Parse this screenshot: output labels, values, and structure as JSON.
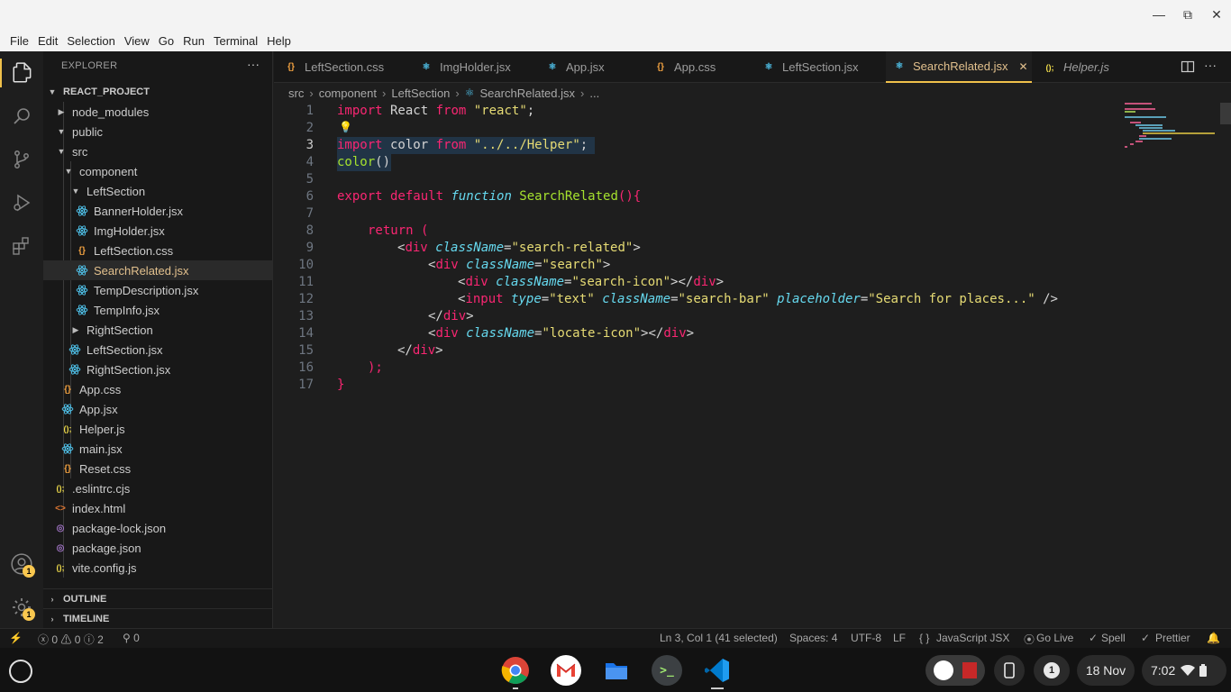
{
  "menu": [
    "File",
    "Edit",
    "Selection",
    "View",
    "Go",
    "Run",
    "Terminal",
    "Help"
  ],
  "window_controls": {
    "minimize": "—",
    "maximize": "⧉",
    "close": "✕"
  },
  "explorer": {
    "title": "EXPLORER",
    "more": "···",
    "project": "REACT_PROJECT",
    "items": [
      {
        "label": "node_modules",
        "kind": "folder"
      },
      {
        "label": "public",
        "kind": "folder"
      },
      {
        "label": "src",
        "kind": "folder-open"
      },
      {
        "label": "component",
        "kind": "folder-open"
      },
      {
        "label": "LeftSection",
        "kind": "folder-open"
      },
      {
        "label": "BannerHolder.jsx",
        "kind": "react"
      },
      {
        "label": "ImgHolder.jsx",
        "kind": "react"
      },
      {
        "label": "LeftSection.css",
        "kind": "css"
      },
      {
        "label": "SearchRelated.jsx",
        "kind": "react"
      },
      {
        "label": "TempDescription.jsx",
        "kind": "react"
      },
      {
        "label": "TempInfo.jsx",
        "kind": "react"
      },
      {
        "label": "RightSection",
        "kind": "folder"
      },
      {
        "label": "LeftSection.jsx",
        "kind": "react"
      },
      {
        "label": "RightSection.jsx",
        "kind": "react"
      },
      {
        "label": "App.css",
        "kind": "css"
      },
      {
        "label": "App.jsx",
        "kind": "react"
      },
      {
        "label": "Helper.js",
        "kind": "js"
      },
      {
        "label": "main.jsx",
        "kind": "react"
      },
      {
        "label": "Reset.css",
        "kind": "css"
      },
      {
        "label": ".eslintrc.cjs",
        "kind": "js"
      },
      {
        "label": "index.html",
        "kind": "html"
      },
      {
        "label": "package-lock.json",
        "kind": "json"
      },
      {
        "label": "package.json",
        "kind": "json"
      },
      {
        "label": "vite.config.js",
        "kind": "js"
      }
    ],
    "outline": "OUTLINE",
    "timeline": "TIMELINE"
  },
  "tabs": [
    {
      "label": "LeftSection.css",
      "icon": "css-icon"
    },
    {
      "label": "ImgHolder.jsx",
      "icon": "react-icon"
    },
    {
      "label": "App.jsx",
      "icon": "react-icon"
    },
    {
      "label": "App.css",
      "icon": "css-icon"
    },
    {
      "label": "LeftSection.jsx",
      "icon": "react-icon"
    },
    {
      "label": "SearchRelated.jsx",
      "icon": "react-icon",
      "active": true,
      "close": "✕"
    },
    {
      "label": "Helper.js",
      "icon": "js-icon"
    }
  ],
  "breadcrumb": [
    "src",
    "component",
    "LeftSection",
    "SearchRelated.jsx",
    "..."
  ],
  "line_numbers": [
    "1",
    "2",
    "3",
    "4",
    "5",
    "6",
    "7",
    "8",
    "9",
    "10",
    "11",
    "12",
    "13",
    "14",
    "15",
    "16",
    "17"
  ],
  "code": {
    "l1": [
      "import",
      " React ",
      "from",
      " \"react\"",
      ";"
    ],
    "l3": [
      "import",
      " color ",
      "from",
      " \"../../Helper\"",
      ";"
    ],
    "l4": [
      "color",
      "()"
    ],
    "l6": [
      "export",
      " default ",
      "function",
      " SearchRelated",
      "(){"
    ],
    "l8": [
      "return",
      " ("
    ],
    "l9": [
      "<",
      "div",
      " ",
      "className",
      "=",
      "\"search-related\"",
      ">"
    ],
    "l10": [
      "<",
      "div",
      " ",
      "className",
      "=",
      "\"search\"",
      ">"
    ],
    "l11": [
      "<",
      "div",
      " ",
      "className",
      "=",
      "\"search-icon\"",
      "></",
      "div",
      ">"
    ],
    "l12": [
      "<",
      "input",
      " ",
      "type",
      "=",
      "\"text\"",
      " ",
      "className",
      "=",
      "\"search-bar\"",
      " ",
      "placeholder",
      "=",
      "\"Search for places...\"",
      " />"
    ],
    "l13": [
      "</",
      "div",
      ">"
    ],
    "l14": [
      "<",
      "div",
      " ",
      "className",
      "=",
      "\"locate-icon\"",
      "></",
      "div",
      ">"
    ],
    "l15": [
      "</",
      "div",
      ">"
    ],
    "l16": [
      ");"
    ],
    "l17": [
      "}"
    ]
  },
  "status": {
    "errors": "0",
    "warnings": "0",
    "info": "2",
    "ports": "0",
    "position": "Ln 3, Col 1 (41 selected)",
    "spaces": "Spaces: 4",
    "encoding": "UTF-8",
    "eol": "LF",
    "language": "JavaScript JSX",
    "golive": "Go Live",
    "spell": "Spell",
    "prettier": "Prettier"
  },
  "activity_badges": {
    "accounts": "1",
    "manage": "1"
  },
  "shelf": {
    "date": "18 Nov",
    "time": "7:02",
    "notifications": "1"
  },
  "colors": {
    "accent": "#f0c14b",
    "selected_label": "#e2c08d",
    "react": "#4fc1e9"
  }
}
